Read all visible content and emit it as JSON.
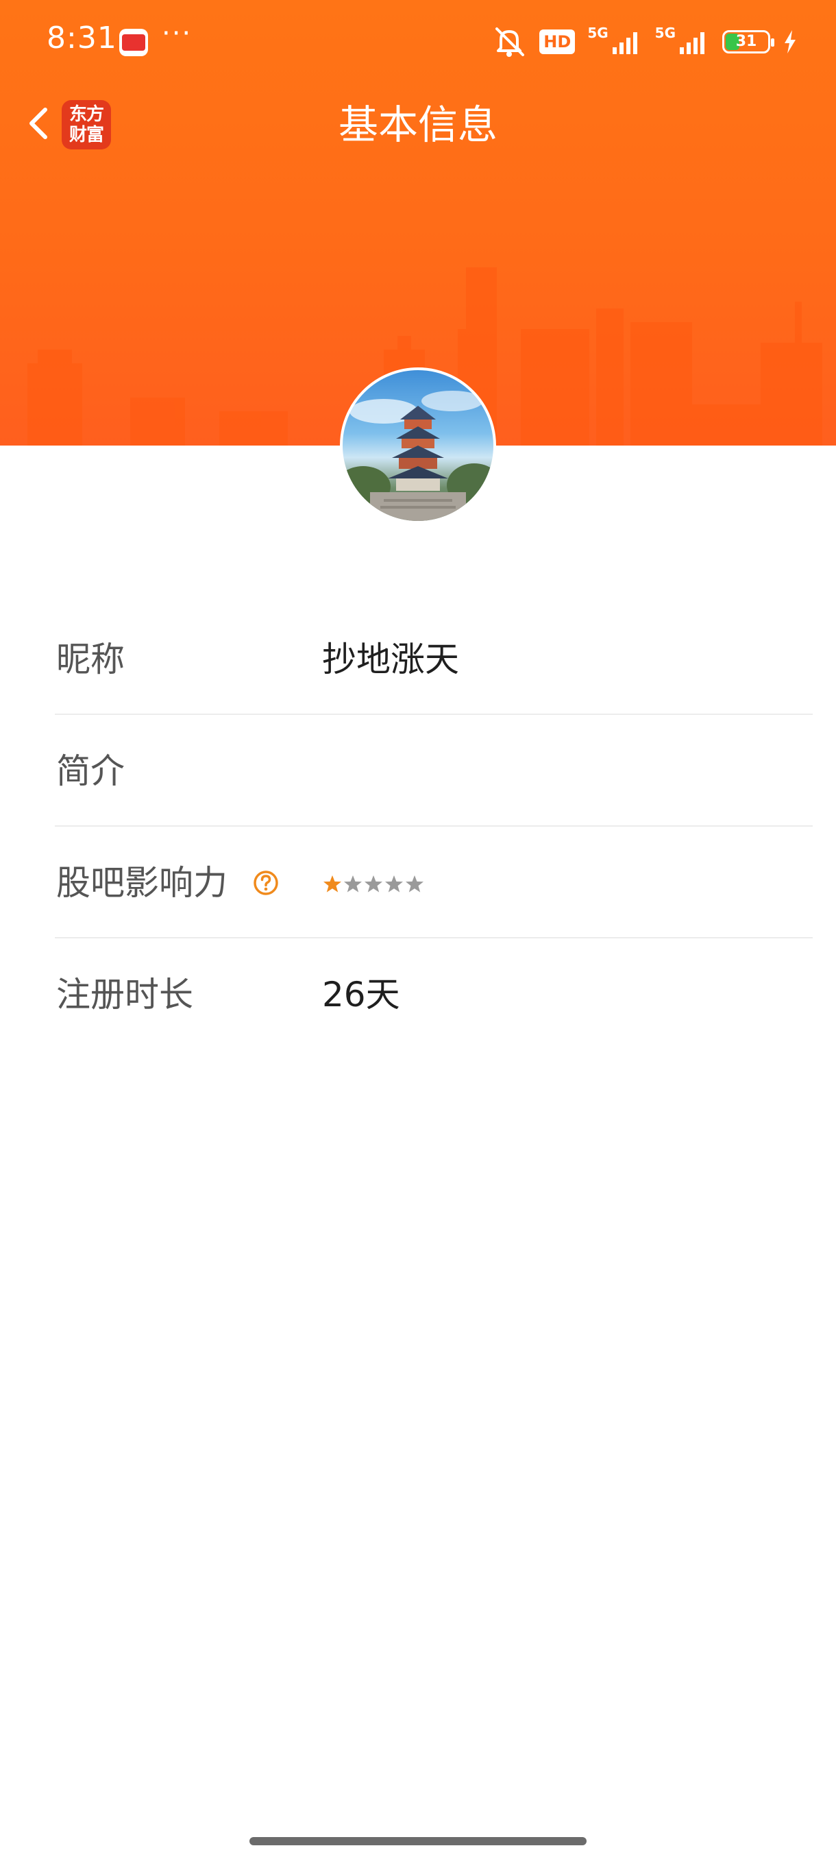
{
  "status_bar": {
    "time": "8:31",
    "notification_app_icon": "toutiao-app-icon",
    "more": "···",
    "hd_label": "HD",
    "network_1": "5G",
    "network_2": "5G",
    "battery_level": "31",
    "icons": [
      "mute-icon",
      "signal-icon",
      "signal-icon",
      "battery-icon",
      "charging-icon"
    ]
  },
  "nav": {
    "back_icon": "chevron-left-icon",
    "logo_line1": "东方",
    "logo_line2": "财富",
    "title": "基本信息"
  },
  "profile": {
    "avatar_icon": "profile-photo"
  },
  "info": [
    {
      "label": "昵称",
      "value": "抄地涨天"
    },
    {
      "label": "简介",
      "value": ""
    },
    {
      "label": "股吧影响力",
      "help_icon": "question-circle-icon",
      "rating": 1,
      "rating_max": 5
    },
    {
      "label": "注册时长",
      "value": "26天"
    }
  ],
  "colors": {
    "brand_orange": "#ff6b18",
    "star_active": "#f08a1c",
    "star_inactive": "#9a9a9a",
    "label_text": "#555555",
    "value_text": "#1f1f1f"
  }
}
